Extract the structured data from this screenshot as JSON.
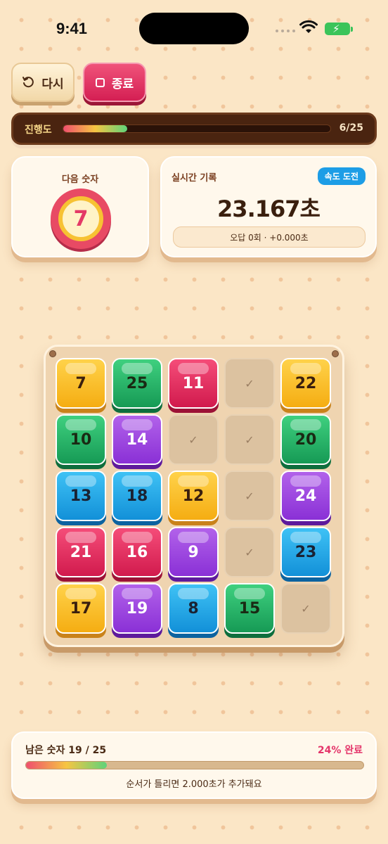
{
  "status_bar": {
    "time": "9:41"
  },
  "top_buttons": {
    "restart_label": "다시",
    "quit_label": "종료"
  },
  "progress": {
    "label": "진행도",
    "count": "6/25",
    "fraction": 0.24
  },
  "next_number": {
    "label": "다음 숫자",
    "value": "7"
  },
  "record": {
    "label": "실시간 기록",
    "badge": "속도 도전",
    "time": "23.167초",
    "sub": "오답 0회 · +0.000초"
  },
  "board": {
    "cleared_mark": "✓",
    "tiles": [
      {
        "value": "7",
        "color": "yellow"
      },
      {
        "value": "25",
        "color": "green"
      },
      {
        "value": "11",
        "color": "pink"
      },
      {
        "value": "",
        "color": "cleared"
      },
      {
        "value": "22",
        "color": "yellow"
      },
      {
        "value": "10",
        "color": "green"
      },
      {
        "value": "14",
        "color": "purple"
      },
      {
        "value": "",
        "color": "cleared"
      },
      {
        "value": "",
        "color": "cleared"
      },
      {
        "value": "20",
        "color": "green"
      },
      {
        "value": "13",
        "color": "blue"
      },
      {
        "value": "18",
        "color": "blue"
      },
      {
        "value": "12",
        "color": "yellow"
      },
      {
        "value": "",
        "color": "cleared"
      },
      {
        "value": "24",
        "color": "purple"
      },
      {
        "value": "21",
        "color": "pink"
      },
      {
        "value": "16",
        "color": "pink"
      },
      {
        "value": "9",
        "color": "purple"
      },
      {
        "value": "",
        "color": "cleared"
      },
      {
        "value": "23",
        "color": "blue"
      },
      {
        "value": "17",
        "color": "yellow"
      },
      {
        "value": "19",
        "color": "purple"
      },
      {
        "value": "8",
        "color": "blue"
      },
      {
        "value": "15",
        "color": "green"
      },
      {
        "value": "",
        "color": "cleared"
      }
    ]
  },
  "bottom": {
    "remaining": "남은 숫자 19 / 25",
    "complete": "24% 완료",
    "fraction": 0.24,
    "note": "순서가 틀리면 2.000초가 추가돼요"
  },
  "colors": {
    "accent_pink": "#e4356a",
    "badge_blue": "#1d9de6",
    "panel_brown": "#4a2410"
  }
}
